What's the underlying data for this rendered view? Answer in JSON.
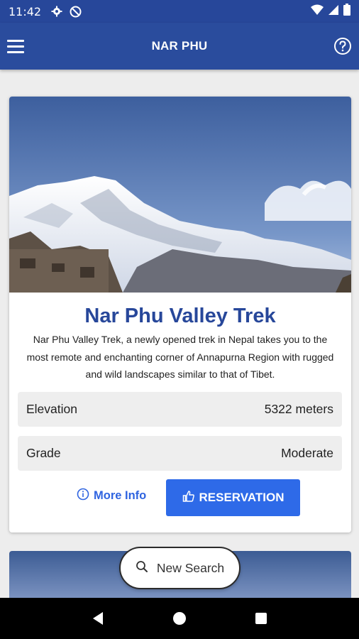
{
  "status_bar": {
    "time": "11:42",
    "icons": [
      "settings-icon",
      "blocked-icon",
      "wifi-icon",
      "signal-icon",
      "battery-icon"
    ]
  },
  "app_bar": {
    "title": "NAR PHU",
    "left_icon": "menu-icon",
    "right_icon": "help-icon"
  },
  "card": {
    "image": "snow-capped mountain",
    "title": "Nar Phu Valley Trek",
    "description": "Nar Phu Valley Trek, a newly opened trek in Nepal takes you to the most remote and enchanting corner of Annapurna Region with rugged and wild landscapes similar to that of Tibet.",
    "rows": [
      {
        "label": "Elevation",
        "value": "5322 meters"
      },
      {
        "label": "Grade",
        "value": "Moderate"
      }
    ],
    "more_info_label": "More Info",
    "reservation_label": "RESERVATION"
  },
  "search_button": {
    "label": "New Search"
  },
  "colors": {
    "primary": "#2a4c9d",
    "accent": "#2e6ae8",
    "title": "#27479a"
  }
}
